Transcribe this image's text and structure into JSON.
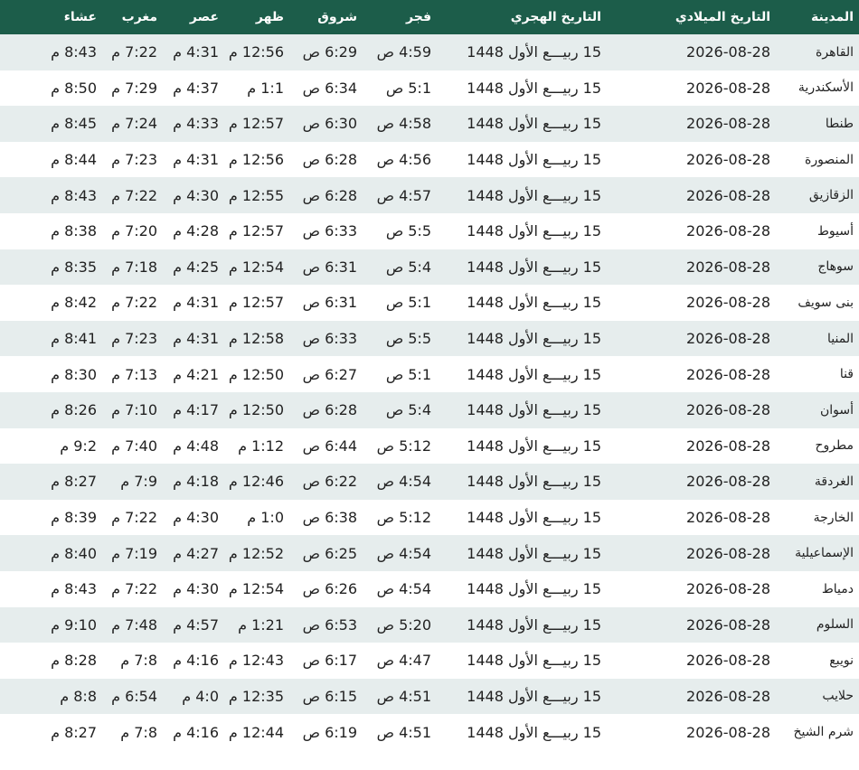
{
  "headers": {
    "city": "المدينة",
    "greg": "التاريخ الميلادي",
    "hijri": "التاريخ الهجري",
    "fajr": "فجر",
    "shurooq": "شروق",
    "dhuhr": "ظهر",
    "asr": "عصر",
    "maghrib": "مغرب",
    "isha": "عشاء"
  },
  "rows": [
    {
      "city": "القاهرة",
      "greg": "2026-08-28",
      "hijri": "15 ربيـــع الأول 1448",
      "fajr": "4:59 ص",
      "shurooq": "6:29 ص",
      "dhuhr": "12:56 م",
      "asr": "4:31 م",
      "maghrib": "7:22 م",
      "isha": "8:43 م"
    },
    {
      "city": "الأسكندرية",
      "greg": "2026-08-28",
      "hijri": "15 ربيـــع الأول 1448",
      "fajr": "5:1 ص",
      "shurooq": "6:34 ص",
      "dhuhr": "1:1 م",
      "asr": "4:37 م",
      "maghrib": "7:29 م",
      "isha": "8:50 م"
    },
    {
      "city": "طنطا",
      "greg": "2026-08-28",
      "hijri": "15 ربيـــع الأول 1448",
      "fajr": "4:58 ص",
      "shurooq": "6:30 ص",
      "dhuhr": "12:57 م",
      "asr": "4:33 م",
      "maghrib": "7:24 م",
      "isha": "8:45 م"
    },
    {
      "city": "المنصورة",
      "greg": "2026-08-28",
      "hijri": "15 ربيـــع الأول 1448",
      "fajr": "4:56 ص",
      "shurooq": "6:28 ص",
      "dhuhr": "12:56 م",
      "asr": "4:31 م",
      "maghrib": "7:23 م",
      "isha": "8:44 م"
    },
    {
      "city": "الزقازيق",
      "greg": "2026-08-28",
      "hijri": "15 ربيـــع الأول 1448",
      "fajr": "4:57 ص",
      "shurooq": "6:28 ص",
      "dhuhr": "12:55 م",
      "asr": "4:30 م",
      "maghrib": "7:22 م",
      "isha": "8:43 م"
    },
    {
      "city": "أسيوط",
      "greg": "2026-08-28",
      "hijri": "15 ربيـــع الأول 1448",
      "fajr": "5:5 ص",
      "shurooq": "6:33 ص",
      "dhuhr": "12:57 م",
      "asr": "4:28 م",
      "maghrib": "7:20 م",
      "isha": "8:38 م"
    },
    {
      "city": "سوهاج",
      "greg": "2026-08-28",
      "hijri": "15 ربيـــع الأول 1448",
      "fajr": "5:4 ص",
      "shurooq": "6:31 ص",
      "dhuhr": "12:54 م",
      "asr": "4:25 م",
      "maghrib": "7:18 م",
      "isha": "8:35 م"
    },
    {
      "city": "بنى سويف",
      "greg": "2026-08-28",
      "hijri": "15 ربيـــع الأول 1448",
      "fajr": "5:1 ص",
      "shurooq": "6:31 ص",
      "dhuhr": "12:57 م",
      "asr": "4:31 م",
      "maghrib": "7:22 م",
      "isha": "8:42 م"
    },
    {
      "city": "المنيا",
      "greg": "2026-08-28",
      "hijri": "15 ربيـــع الأول 1448",
      "fajr": "5:5 ص",
      "shurooq": "6:33 ص",
      "dhuhr": "12:58 م",
      "asr": "4:31 م",
      "maghrib": "7:23 م",
      "isha": "8:41 م"
    },
    {
      "city": "قنا",
      "greg": "2026-08-28",
      "hijri": "15 ربيـــع الأول 1448",
      "fajr": "5:1 ص",
      "shurooq": "6:27 ص",
      "dhuhr": "12:50 م",
      "asr": "4:21 م",
      "maghrib": "7:13 م",
      "isha": "8:30 م"
    },
    {
      "city": "أسوان",
      "greg": "2026-08-28",
      "hijri": "15 ربيـــع الأول 1448",
      "fajr": "5:4 ص",
      "shurooq": "6:28 ص",
      "dhuhr": "12:50 م",
      "asr": "4:17 م",
      "maghrib": "7:10 م",
      "isha": "8:26 م"
    },
    {
      "city": "مطروح",
      "greg": "2026-08-28",
      "hijri": "15 ربيـــع الأول 1448",
      "fajr": "5:12 ص",
      "shurooq": "6:44 ص",
      "dhuhr": "1:12 م",
      "asr": "4:48 م",
      "maghrib": "7:40 م",
      "isha": "9:2 م"
    },
    {
      "city": "الغردقة",
      "greg": "2026-08-28",
      "hijri": "15 ربيـــع الأول 1448",
      "fajr": "4:54 ص",
      "shurooq": "6:22 ص",
      "dhuhr": "12:46 م",
      "asr": "4:18 م",
      "maghrib": "7:9 م",
      "isha": "8:27 م"
    },
    {
      "city": "الخارجة",
      "greg": "2026-08-28",
      "hijri": "15 ربيـــع الأول 1448",
      "fajr": "5:12 ص",
      "shurooq": "6:38 ص",
      "dhuhr": "1:0 م",
      "asr": "4:30 م",
      "maghrib": "7:22 م",
      "isha": "8:39 م"
    },
    {
      "city": "الإسماعيلية",
      "greg": "2026-08-28",
      "hijri": "15 ربيـــع الأول 1448",
      "fajr": "4:54 ص",
      "shurooq": "6:25 ص",
      "dhuhr": "12:52 م",
      "asr": "4:27 م",
      "maghrib": "7:19 م",
      "isha": "8:40 م"
    },
    {
      "city": "دمياط",
      "greg": "2026-08-28",
      "hijri": "15 ربيـــع الأول 1448",
      "fajr": "4:54 ص",
      "shurooq": "6:26 ص",
      "dhuhr": "12:54 م",
      "asr": "4:30 م",
      "maghrib": "7:22 م",
      "isha": "8:43 م"
    },
    {
      "city": "السلوم",
      "greg": "2026-08-28",
      "hijri": "15 ربيـــع الأول 1448",
      "fajr": "5:20 ص",
      "shurooq": "6:53 ص",
      "dhuhr": "1:21 م",
      "asr": "4:57 م",
      "maghrib": "7:48 م",
      "isha": "9:10 م"
    },
    {
      "city": "نويبع",
      "greg": "2026-08-28",
      "hijri": "15 ربيـــع الأول 1448",
      "fajr": "4:47 ص",
      "shurooq": "6:17 ص",
      "dhuhr": "12:43 م",
      "asr": "4:16 م",
      "maghrib": "7:8 م",
      "isha": "8:28 م"
    },
    {
      "city": "حلايب",
      "greg": "2026-08-28",
      "hijri": "15 ربيـــع الأول 1448",
      "fajr": "4:51 ص",
      "shurooq": "6:15 ص",
      "dhuhr": "12:35 م",
      "asr": "4:0 م",
      "maghrib": "6:54 م",
      "isha": "8:8 م"
    },
    {
      "city": "شرم الشيخ",
      "greg": "2026-08-28",
      "hijri": "15 ربيـــع الأول 1448",
      "fajr": "4:51 ص",
      "shurooq": "6:19 ص",
      "dhuhr": "12:44 م",
      "asr": "4:16 م",
      "maghrib": "7:8 م",
      "isha": "8:27 م"
    }
  ]
}
